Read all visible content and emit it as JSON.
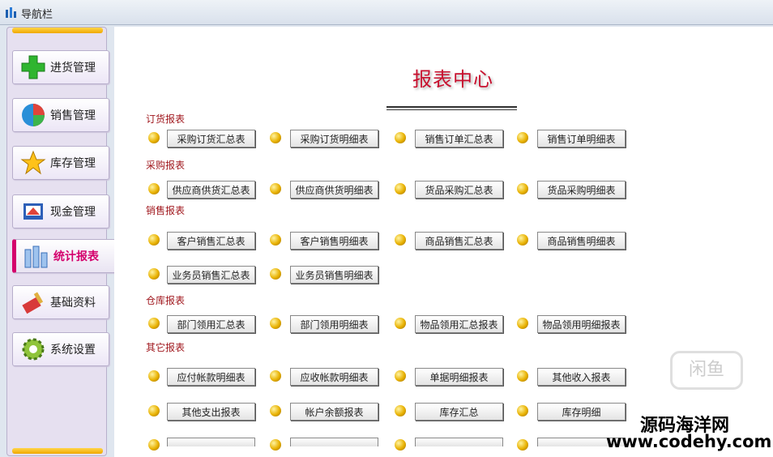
{
  "window": {
    "title": "导航栏"
  },
  "sidebar": {
    "items": [
      {
        "label": "进货管理",
        "icon": "plus-icon",
        "active": false
      },
      {
        "label": "销售管理",
        "icon": "globe-icon",
        "active": false
      },
      {
        "label": "库存管理",
        "icon": "star-icon",
        "active": false
      },
      {
        "label": "现金管理",
        "icon": "cash-register-icon",
        "active": false
      },
      {
        "label": "统计报表",
        "icon": "bar-chart-icon",
        "active": true
      },
      {
        "label": "基础资料",
        "icon": "brush-icon",
        "active": false
      },
      {
        "label": "系统设置",
        "icon": "gear-icon",
        "active": false
      }
    ]
  },
  "main": {
    "title": "报表中心",
    "sections": [
      {
        "label": "订货报表",
        "buttons": [
          "采购订货汇总表",
          "采购订货明细表",
          "销售订单汇总表",
          "销售订单明细表"
        ]
      },
      {
        "label": "采购报表",
        "buttons": [
          "供应商供货汇总表",
          "供应商供货明细表",
          "货品采购汇总表",
          "货品采购明细表"
        ]
      },
      {
        "label": "销售报表",
        "buttons": [
          "客户销售汇总表",
          "客户销售明细表",
          "商品销售汇总表",
          "商品销售明细表",
          "业务员销售汇总表",
          "业务员销售明细表"
        ]
      },
      {
        "label": "仓库报表",
        "buttons": [
          "部门领用汇总表",
          "部门领用明细表",
          "物品领用汇总报表",
          "物品领用明细报表"
        ]
      },
      {
        "label": "其它报表",
        "buttons": [
          "应付帐款明细表",
          "应收帐款明细表",
          "单据明细报表",
          "其他收入报表",
          "其他支出报表",
          "帐户余额报表",
          "库存汇总",
          "库存明细"
        ]
      }
    ]
  },
  "watermark": {
    "site_zh": "源码海洋网",
    "site_en": "www.codehy.com",
    "faint": "闲鱼"
  },
  "colors": {
    "accent": "#d4006c",
    "section": "#a0181e",
    "title": "#c8102e"
  }
}
